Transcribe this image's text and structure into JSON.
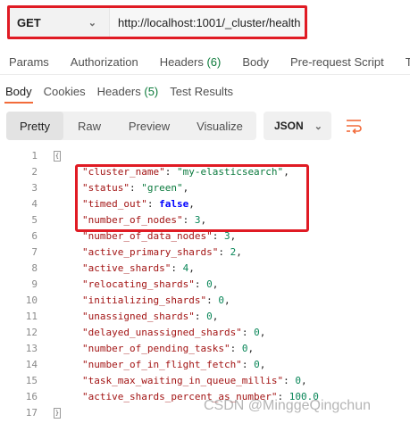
{
  "request": {
    "method": "GET",
    "url": "http://localhost:1001/_cluster/health"
  },
  "request_tabs": [
    {
      "label": "Params",
      "count": ""
    },
    {
      "label": "Authorization",
      "count": ""
    },
    {
      "label": "Headers ",
      "count": "(6)"
    },
    {
      "label": "Body",
      "count": ""
    },
    {
      "label": "Pre-request Script",
      "count": ""
    },
    {
      "label": "T",
      "count": ""
    }
  ],
  "response_tabs": [
    {
      "label": "Body",
      "count": ""
    },
    {
      "label": "Cookies",
      "count": ""
    },
    {
      "label": "Headers ",
      "count": "(5)"
    },
    {
      "label": "Test Results",
      "count": ""
    }
  ],
  "view_modes": [
    "Pretty",
    "Raw",
    "Preview",
    "Visualize"
  ],
  "format": "JSON",
  "code_lines": [
    {
      "n": "1",
      "key": "",
      "value": "",
      "type": "open"
    },
    {
      "n": "2",
      "key": "\"cluster_name\"",
      "value": "\"my-elasticsearch\"",
      "type": "str"
    },
    {
      "n": "3",
      "key": "\"status\"",
      "value": "\"green\"",
      "type": "str"
    },
    {
      "n": "4",
      "key": "\"timed_out\"",
      "value": "false",
      "type": "bool"
    },
    {
      "n": "5",
      "key": "\"number_of_nodes\"",
      "value": "3",
      "type": "num"
    },
    {
      "n": "6",
      "key": "\"number_of_data_nodes\"",
      "value": "3",
      "type": "num"
    },
    {
      "n": "7",
      "key": "\"active_primary_shards\"",
      "value": "2",
      "type": "num"
    },
    {
      "n": "8",
      "key": "\"active_shards\"",
      "value": "4",
      "type": "num"
    },
    {
      "n": "9",
      "key": "\"relocating_shards\"",
      "value": "0",
      "type": "num"
    },
    {
      "n": "10",
      "key": "\"initializing_shards\"",
      "value": "0",
      "type": "num"
    },
    {
      "n": "11",
      "key": "\"unassigned_shards\"",
      "value": "0",
      "type": "num"
    },
    {
      "n": "12",
      "key": "\"delayed_unassigned_shards\"",
      "value": "0",
      "type": "num"
    },
    {
      "n": "13",
      "key": "\"number_of_pending_tasks\"",
      "value": "0",
      "type": "num"
    },
    {
      "n": "14",
      "key": "\"number_of_in_flight_fetch\"",
      "value": "0",
      "type": "num"
    },
    {
      "n": "15",
      "key": "\"task_max_waiting_in_queue_millis\"",
      "value": "0",
      "type": "num"
    },
    {
      "n": "16",
      "key": "\"active_shards_percent_as_number\"",
      "value": "100.0",
      "type": "num-last"
    },
    {
      "n": "17",
      "key": "",
      "value": "",
      "type": "close"
    }
  ],
  "watermark": "CSDN @MinggeQingchun",
  "colors": {
    "highlight": "#e01b24",
    "active_tab": "#f26b3a",
    "count_green": "#0c7a3a",
    "wrap_icon": "#f26b3a"
  }
}
